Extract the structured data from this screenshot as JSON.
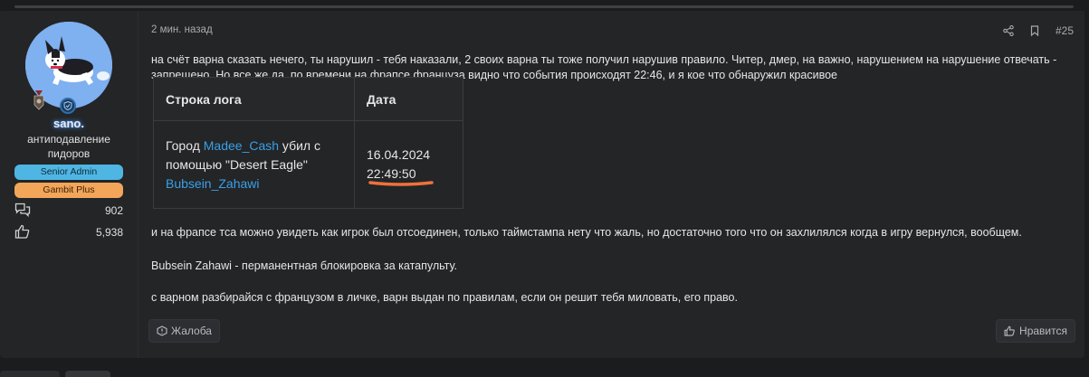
{
  "post": {
    "time": "2 мин. назад",
    "number": "#25",
    "author": {
      "name": "sano.",
      "title": "антиподавление пидоров",
      "badges": [
        "Senior Admin",
        "Gambit Plus"
      ],
      "messages": "902",
      "likes": "5,938"
    },
    "paragraph1": "на счёт варна сказать нечего, ты нарушил - тебя наказали, 2 своих варна ты тоже получил нарушив правило. Читер, дмер, на важно, нарушением на нарушение отвечать - запрещено. Но все же да, по времени на фрапсе француза видно что события происходят 22:46, и я кое что обнаружил красивое",
    "table": {
      "headers": [
        "Строка лога",
        "Дата"
      ],
      "row": {
        "part1": "Город ",
        "player1": "Madee_Cash",
        "part2": " убил с помощью \"Desert Eagle\" ",
        "player2": "Bubsein_Zahawi",
        "date": "16.04.2024",
        "time": "22:49:50"
      }
    },
    "paragraph2": "и на фрапсе тса можно увидеть как игрок был отсоединен, только таймстампа нету что жаль, но достаточно того что он захлилялся когда в игру вернулся, вообщем.",
    "paragraph3": "Bubsein Zahawi - перманентная блокировка за катапульту.",
    "paragraph4": "с варном разбирайся с французом в личке, варн выдан по правилам, если он решит тебя миловать, его право.",
    "report_label": "Жалоба",
    "like_label": "Нравится"
  },
  "icons": [
    "medal-icon",
    "shield-check-icon",
    "messages-icon",
    "thumbs-up-icon",
    "share-icon",
    "bookmark-icon",
    "report-icon",
    "like-icon"
  ],
  "colors": {
    "background": "#1b1c1e",
    "post_bg": "#232527",
    "link": "#3aa0e8",
    "badge_admin": "#4fb6e3",
    "badge_gambit": "#f3a55a",
    "highlight": "#f0703c"
  }
}
